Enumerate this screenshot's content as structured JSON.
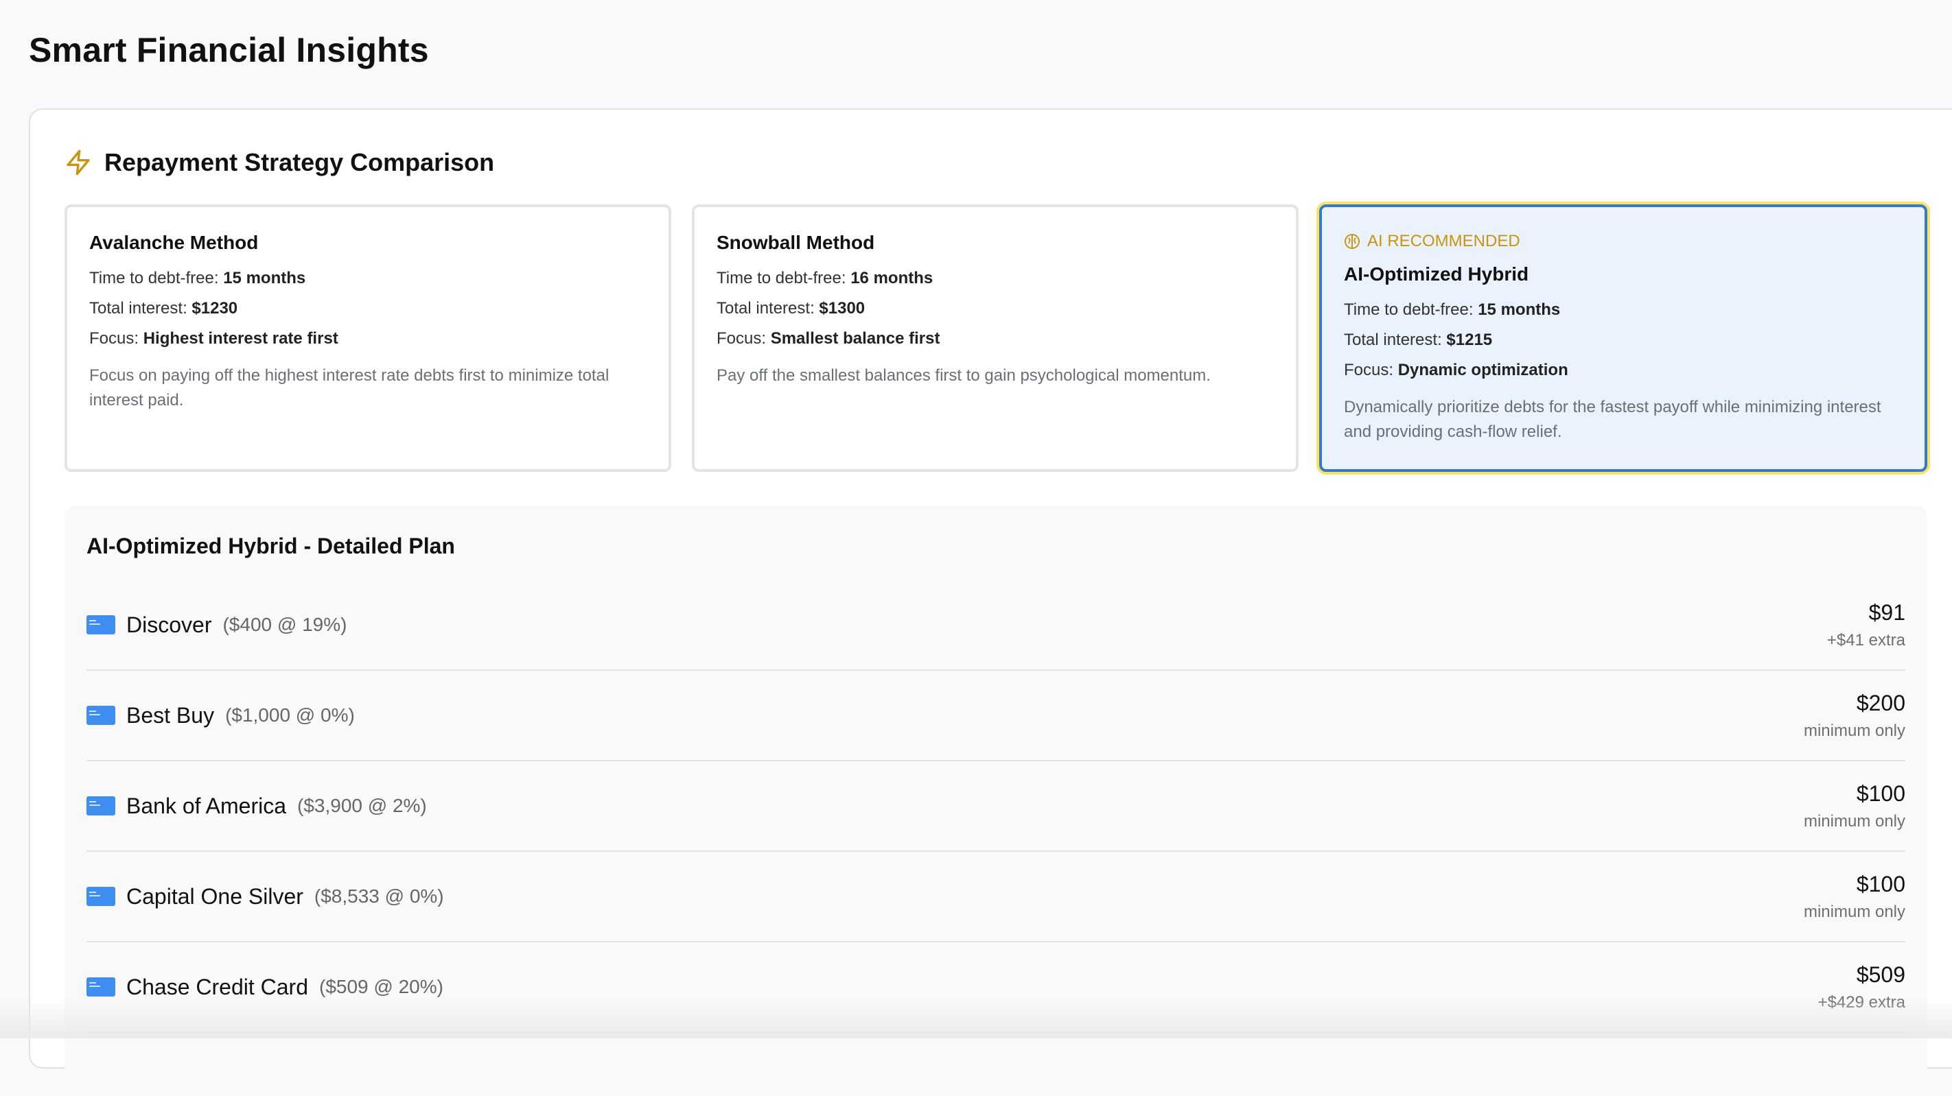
{
  "page": {
    "title": "Smart Financial Insights"
  },
  "section": {
    "title": "Repayment Strategy Comparison",
    "icon": "lightning-bolt-icon"
  },
  "labels": {
    "time": "Time to debt-free:",
    "interest": "Total interest:",
    "focus": "Focus:"
  },
  "strategies": [
    {
      "name": "Avalanche Method",
      "time": "15 months",
      "interest": "$1230",
      "focus": "Highest interest rate first",
      "description": "Focus on paying off the highest interest rate debts first to minimize total interest paid."
    },
    {
      "name": "Snowball Method",
      "time": "16 months",
      "interest": "$1300",
      "focus": "Smallest balance first",
      "description": "Pay off the smallest balances first to gain psychological momentum."
    },
    {
      "badge": "AI RECOMMENDED",
      "badge_icon": "brain-icon",
      "name": "AI-Optimized Hybrid",
      "time": "15 months",
      "interest": "$1215",
      "focus": "Dynamic optimization",
      "description": "Dynamically prioritize debts for the fastest payoff while minimizing interest and providing cash-flow relief."
    }
  ],
  "plan": {
    "title": "AI-Optimized Hybrid - Detailed Plan",
    "items": [
      {
        "name": "Discover",
        "detail": "($400 @ 19%)",
        "payment": "$91",
        "note": "+$41 extra"
      },
      {
        "name": "Best Buy",
        "detail": "($1,000 @ 0%)",
        "payment": "$200",
        "note": "minimum only"
      },
      {
        "name": "Bank of America",
        "detail": "($3,900 @ 2%)",
        "payment": "$100",
        "note": "minimum only"
      },
      {
        "name": "Capital One Silver",
        "detail": "($8,533 @ 0%)",
        "payment": "$100",
        "note": "minimum only"
      },
      {
        "name": "Chase Credit Card",
        "detail": "($509 @ 20%)",
        "payment": "$509",
        "note": "+$429 extra"
      }
    ]
  },
  "colors": {
    "accent": "#c9950d",
    "highlight_border": "#3b77c8",
    "card_icon": "#3d8ef0"
  }
}
